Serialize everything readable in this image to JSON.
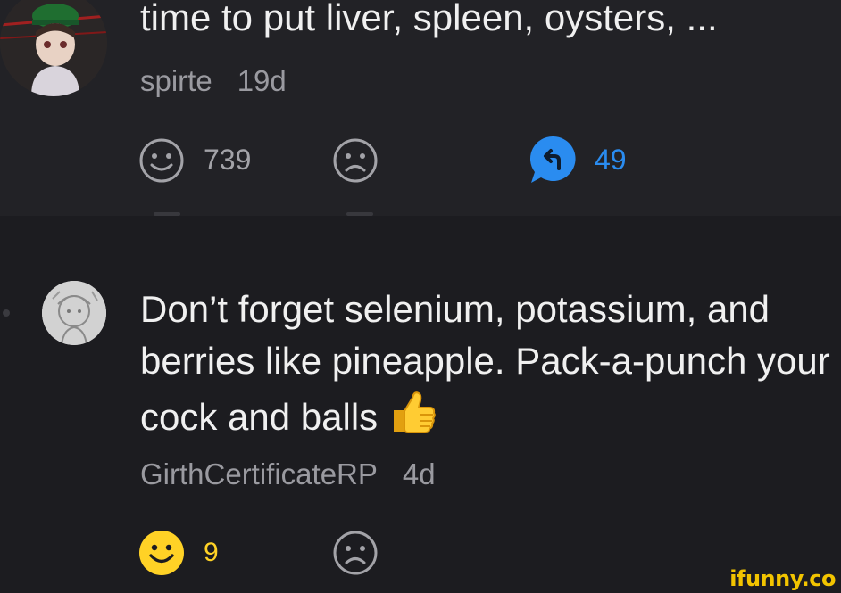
{
  "comment1": {
    "text": "time to put liver, spleen, oysters, ...",
    "username": "spirte",
    "age": "19d",
    "smile_count": "739",
    "reply_count": "49"
  },
  "comment2": {
    "text": "Don’t forget selenium, potassium, and berries like pineapple. Pack-a-punch your cock and balls",
    "username": "GirthCertificateRP",
    "age": "4d",
    "smile_count": "9"
  },
  "icons": {
    "smile": "smile-icon",
    "unsmile": "frown-icon",
    "reply": "reply-bubble-icon",
    "thumbs_up": "thumbs-up-emoji"
  },
  "colors": {
    "accent_blue": "#2a8cf0",
    "smile_active": "#ffd226",
    "muted": "#9a9aa0"
  },
  "watermark": "ifunny.co"
}
